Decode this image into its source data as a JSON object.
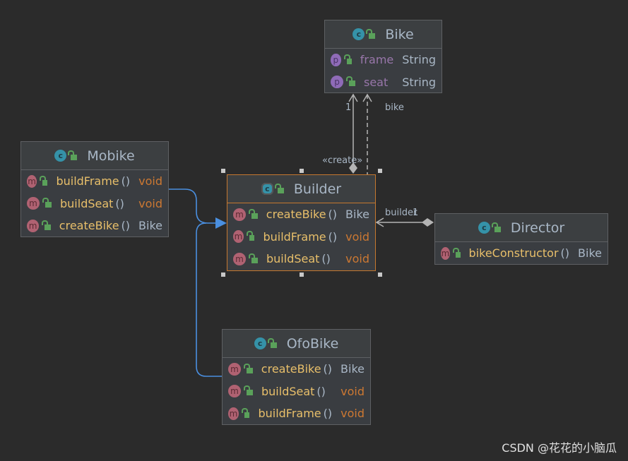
{
  "classes": [
    {
      "id": "bike",
      "name": "Bike",
      "icon": "class-icon",
      "selected": false,
      "members": [
        {
          "kind": "field",
          "name": "frame",
          "type": "String"
        },
        {
          "kind": "field",
          "name": "seat",
          "type": "String"
        }
      ]
    },
    {
      "id": "mobike",
      "name": "Mobike",
      "icon": "class-icon",
      "selected": false,
      "members": [
        {
          "kind": "method",
          "name": "buildFrame",
          "type": "void"
        },
        {
          "kind": "method",
          "name": "buildSeat",
          "type": "void"
        },
        {
          "kind": "method",
          "name": "createBike",
          "type": "Bike"
        }
      ]
    },
    {
      "id": "builder",
      "name": "Builder",
      "icon": "abstract-class-icon",
      "selected": true,
      "members": [
        {
          "kind": "method",
          "name": "createBike",
          "type": "Bike"
        },
        {
          "kind": "method",
          "name": "buildFrame",
          "type": "void"
        },
        {
          "kind": "method",
          "name": "buildSeat",
          "type": "void"
        }
      ]
    },
    {
      "id": "director",
      "name": "Director",
      "icon": "class-icon",
      "selected": false,
      "members": [
        {
          "kind": "method",
          "name": "bikeConstructor",
          "type": "Bike"
        }
      ]
    },
    {
      "id": "ofobike",
      "name": "OfoBike",
      "icon": "class-icon",
      "selected": false,
      "members": [
        {
          "kind": "method",
          "name": "createBike",
          "type": "Bike"
        },
        {
          "kind": "method",
          "name": "buildSeat",
          "type": "void"
        },
        {
          "kind": "method",
          "name": "buildFrame",
          "type": "void"
        }
      ]
    }
  ],
  "relations": {
    "bike_multiplicity": "1",
    "bike_role": "bike",
    "create_stereotype": "«create»",
    "builder_role": "builder",
    "builder_multiplicity": "1"
  },
  "colors": {
    "background": "#2b2b2b",
    "inheritance": "#4a8fe0",
    "selection": "#c5782f",
    "association": "#b4b4b4"
  },
  "watermark": "CSDN @花花的小脑瓜"
}
